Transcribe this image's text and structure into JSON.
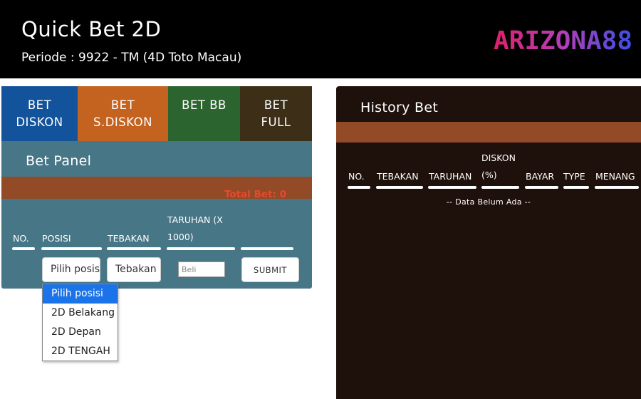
{
  "header": {
    "title": "Quick Bet 2D",
    "periode": "Periode : 9922 - TM (4D Toto Macau)",
    "logo_text": "ARIZONA88"
  },
  "tabs": [
    {
      "line1": "BET",
      "line2": "DISKON"
    },
    {
      "line1": "BET",
      "line2": "S.DISKON"
    },
    {
      "line1": "BET BB",
      "line2": ""
    },
    {
      "line1": "BET",
      "line2": "FULL"
    }
  ],
  "bet_panel": {
    "title": "Bet Panel",
    "total_bet": "Total Bet: 0",
    "columns": {
      "no": "NO.",
      "posisi": "POSISI",
      "tebakan": "TEBAKAN",
      "taruhan_line1": "TARUHAN (X",
      "taruhan_line2": "1000)"
    },
    "posisi_value": "Pilih posisi",
    "tebakan_value": "Tebakan",
    "beli_placeholder": "Beli",
    "submit_label": "SUBMIT"
  },
  "posisi_dropdown": {
    "options": [
      "Pilih posisi",
      "2D Belakang",
      "2D Depan",
      "2D TENGAH"
    ],
    "selected": "Pilih posisi"
  },
  "history": {
    "title": "History Bet",
    "columns": {
      "no": "NO.",
      "tebakan": "TEBAKAN",
      "taruhan": "TARUHAN",
      "diskon_line1": "DISKON",
      "diskon_line2": "(%)",
      "bayar": "BAYAR",
      "type": "TYPE",
      "menang": "MENANG"
    },
    "empty_text": "-- Data Belum Ada --"
  },
  "colors": {
    "tab_diskon": "#13539b",
    "tab_sdiskon": "#c4621f",
    "tab_bb": "#2c6430",
    "tab_full": "#3c2e17",
    "panel_bg": "#477686",
    "accent_bar": "#934a27",
    "total_text": "#e34b2c",
    "history_bg": "#1e100a"
  }
}
